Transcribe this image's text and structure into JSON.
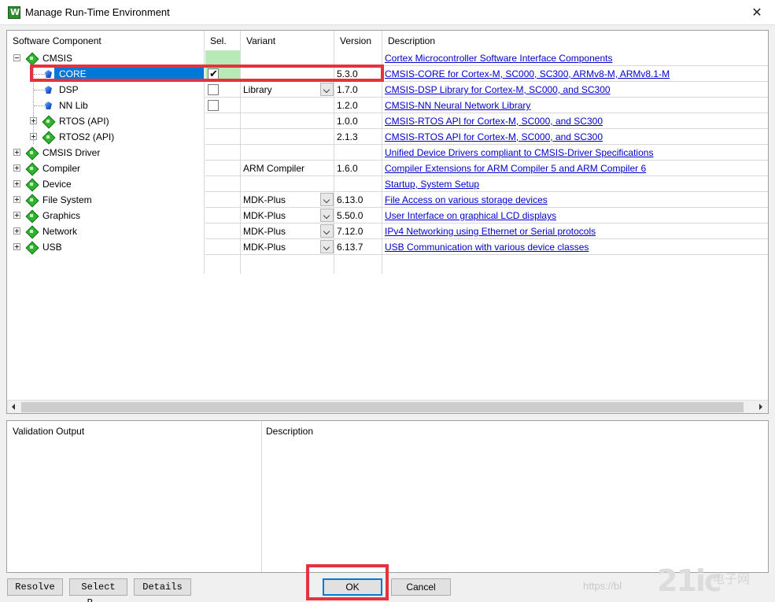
{
  "window": {
    "title": "Manage Run-Time Environment",
    "close_glyph": "✕"
  },
  "columns": {
    "component": "Software Component",
    "sel": "Sel.",
    "variant": "Variant",
    "version": "Version",
    "description": "Description"
  },
  "rows": [
    {
      "name": "CMSIS",
      "variant": "",
      "version": "",
      "description": "Cortex Microcontroller Software Interface Components",
      "icon": "green-diamond-icon",
      "expander": "minus"
    },
    {
      "name": "CORE",
      "variant": "",
      "version": "5.3.0",
      "description": "CMSIS-CORE for Cortex-M, SC000, SC300, ARMv8-M, ARMv8.1-M",
      "icon": "blue-gem-icon",
      "selected": true,
      "checked": true
    },
    {
      "name": "DSP",
      "variant": "Library",
      "version": "1.7.0",
      "description": "CMSIS-DSP Library for Cortex-M, SC000, and SC300",
      "icon": "blue-gem-icon",
      "checked": false,
      "dropdown": true
    },
    {
      "name": "NN Lib",
      "variant": "",
      "version": "1.2.0",
      "description": "CMSIS-NN Neural Network Library",
      "icon": "blue-gem-icon",
      "checked": false
    },
    {
      "name": "RTOS (API)",
      "variant": "",
      "version": "1.0.0",
      "description": "CMSIS-RTOS API for Cortex-M, SC000, and SC300",
      "icon": "green-diamond-icon",
      "expander": "plus"
    },
    {
      "name": "RTOS2 (API)",
      "variant": "",
      "version": "2.1.3",
      "description": "CMSIS-RTOS API for Cortex-M, SC000, and SC300",
      "icon": "green-diamond-icon",
      "expander": "plus"
    },
    {
      "name": "CMSIS Driver",
      "variant": "",
      "version": "",
      "description": "Unified Device Drivers compliant to CMSIS-Driver Specifications",
      "icon": "green-diamond-icon",
      "expander": "plus"
    },
    {
      "name": "Compiler",
      "variant": "ARM Compiler",
      "version": "1.6.0",
      "description": "Compiler Extensions for ARM Compiler 5 and ARM Compiler 6",
      "icon": "green-diamond-icon",
      "expander": "plus"
    },
    {
      "name": "Device",
      "variant": "",
      "version": "",
      "description": "Startup, System Setup",
      "icon": "green-diamond-icon",
      "expander": "plus"
    },
    {
      "name": "File System",
      "variant": "MDK-Plus",
      "version": "6.13.0",
      "description": "File Access on various storage devices",
      "icon": "green-diamond-icon",
      "expander": "plus",
      "dropdown": true
    },
    {
      "name": "Graphics",
      "variant": "MDK-Plus",
      "version": "5.50.0",
      "description": "User Interface on graphical LCD displays",
      "icon": "green-diamond-icon",
      "expander": "plus",
      "dropdown": true
    },
    {
      "name": "Network",
      "variant": "MDK-Plus",
      "version": "7.12.0",
      "description": "IPv4 Networking using Ethernet or Serial protocols",
      "icon": "green-diamond-icon",
      "expander": "plus",
      "dropdown": true
    },
    {
      "name": "USB",
      "variant": "MDK-Plus",
      "version": "6.13.7",
      "description": "USB Communication with various device classes",
      "icon": "green-diamond-icon",
      "expander": "plus",
      "dropdown": true
    }
  ],
  "validation": {
    "output_title": "Validation Output",
    "description_title": "Description"
  },
  "buttons": {
    "resolve": "Resolve",
    "select_packs": "Select P...",
    "details": "Details",
    "ok": "OK",
    "cancel": "Cancel"
  },
  "watermark": {
    "url": "https://bl",
    "logo": "21ic",
    "cn": "电子网"
  },
  "colors": {
    "selection": "#0078d7",
    "link": "#0000cc",
    "highlight": "#e6323c",
    "sel_ok": "#b7eab7"
  }
}
